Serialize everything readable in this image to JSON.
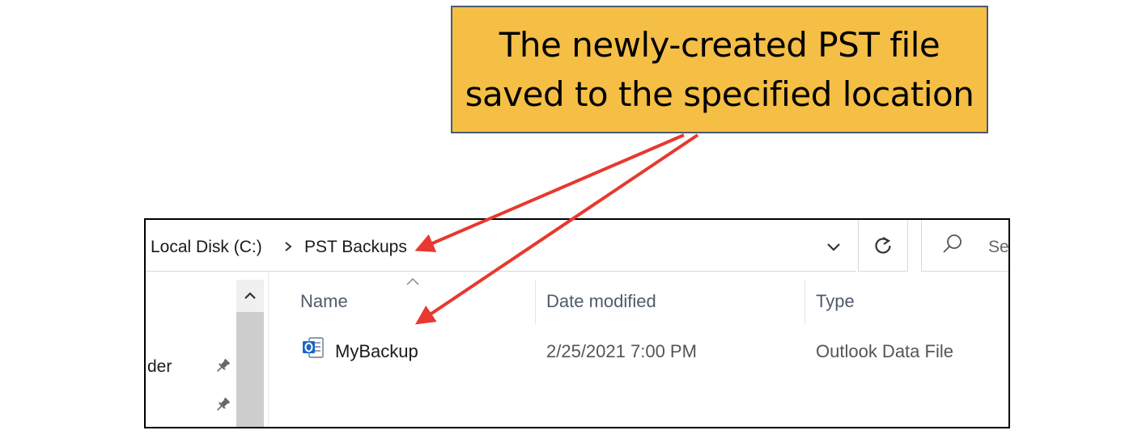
{
  "callout": {
    "text": "The newly-created PST file\nsaved to the specified location"
  },
  "explorer": {
    "breadcrumb": {
      "items": [
        "Local Disk (C:)",
        "PST Backups"
      ],
      "separator": ">"
    },
    "search": {
      "placeholder_visible": "Se"
    },
    "nav": {
      "item_label": "der"
    },
    "columns": [
      "Name",
      "Date modified",
      "Type"
    ],
    "files": [
      {
        "name": "MyBackup",
        "date_modified": "2/25/2021 7:00 PM",
        "type": "Outlook Data File",
        "icon": "outlook-pst-icon"
      }
    ]
  },
  "colors": {
    "callout_fill": "#f5be45",
    "callout_border": "#4a5a78",
    "arrow": "#e8382f",
    "outlook_blue": "#1a66c5"
  }
}
